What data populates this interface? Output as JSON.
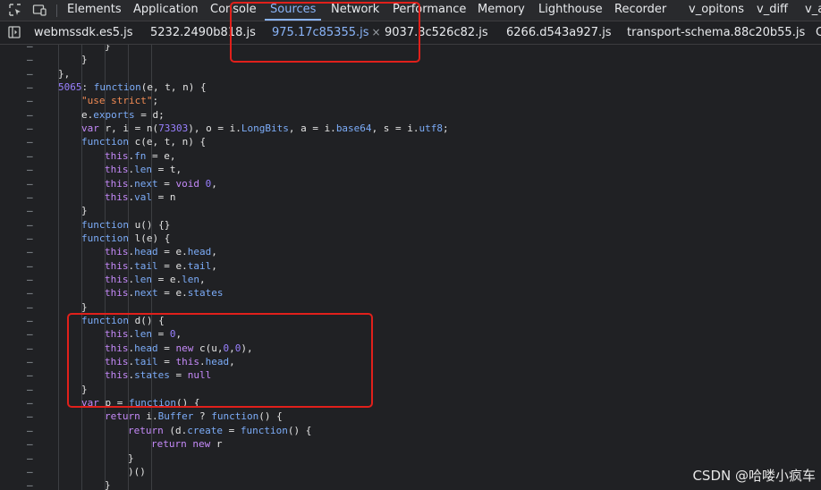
{
  "toolbar": {
    "inspect_icon": "inspect-element-icon",
    "device_icon": "device-toolbar-icon",
    "tabs": [
      {
        "label": "Elements"
      },
      {
        "label": "Application"
      },
      {
        "label": "Console"
      },
      {
        "label": "Sources"
      },
      {
        "label": "Network"
      },
      {
        "label": "Performance"
      },
      {
        "label": "Memory"
      },
      {
        "label": "Lighthouse"
      },
      {
        "label": "Recorder"
      },
      {
        "label": "v_opitons"
      },
      {
        "label": "v_diff"
      },
      {
        "label": "v_a"
      }
    ],
    "active_tab": "Sources"
  },
  "file_tabs": {
    "toggle_icon": "toggle-navigator-icon",
    "tabs": [
      {
        "label": "webmssdk.es5.js"
      },
      {
        "label": "5232.2490b818.js"
      },
      {
        "label": "975.17c85355.js"
      },
      {
        "label": "9037.3c526c82.js"
      },
      {
        "label": "6266.d543a927.js"
      },
      {
        "label": "transport-schema.88c20b55.js"
      },
      {
        "label": "C"
      }
    ],
    "active_file": "975.17c85355.js",
    "close_glyph": "×"
  },
  "code_lines": [
    "                }",
    "            }",
    "        },",
    "        5065: function(e, t, n) {",
    "            \"use strict\";",
    "            e.exports = d;",
    "            var r, i = n(73303), o = i.LongBits, a = i.base64, s = i.utf8;",
    "            function c(e, t, n) {",
    "                this.fn = e,",
    "                this.len = t,",
    "                this.next = void 0,",
    "                this.val = n",
    "            }",
    "            function u() {}",
    "            function l(e) {",
    "                this.head = e.head,",
    "                this.tail = e.tail,",
    "                this.len = e.len,",
    "                this.next = e.states",
    "            }",
    "            function d() {",
    "                this.len = 0,",
    "                this.head = new c(u,0,0),",
    "                this.tail = this.head,",
    "                this.states = null",
    "            }",
    "            var p = function() {",
    "                return i.Buffer ? function() {",
    "                    return (d.create = function() {",
    "                        return new r",
    "                    }",
    "                    )()",
    "                }"
  ],
  "gutter_marker": "–",
  "watermark": "CSDN @哈喽小疯车",
  "colors": {
    "background": "#202124",
    "accent": "#8ab4f8",
    "annotation_red": "#e0201b"
  }
}
